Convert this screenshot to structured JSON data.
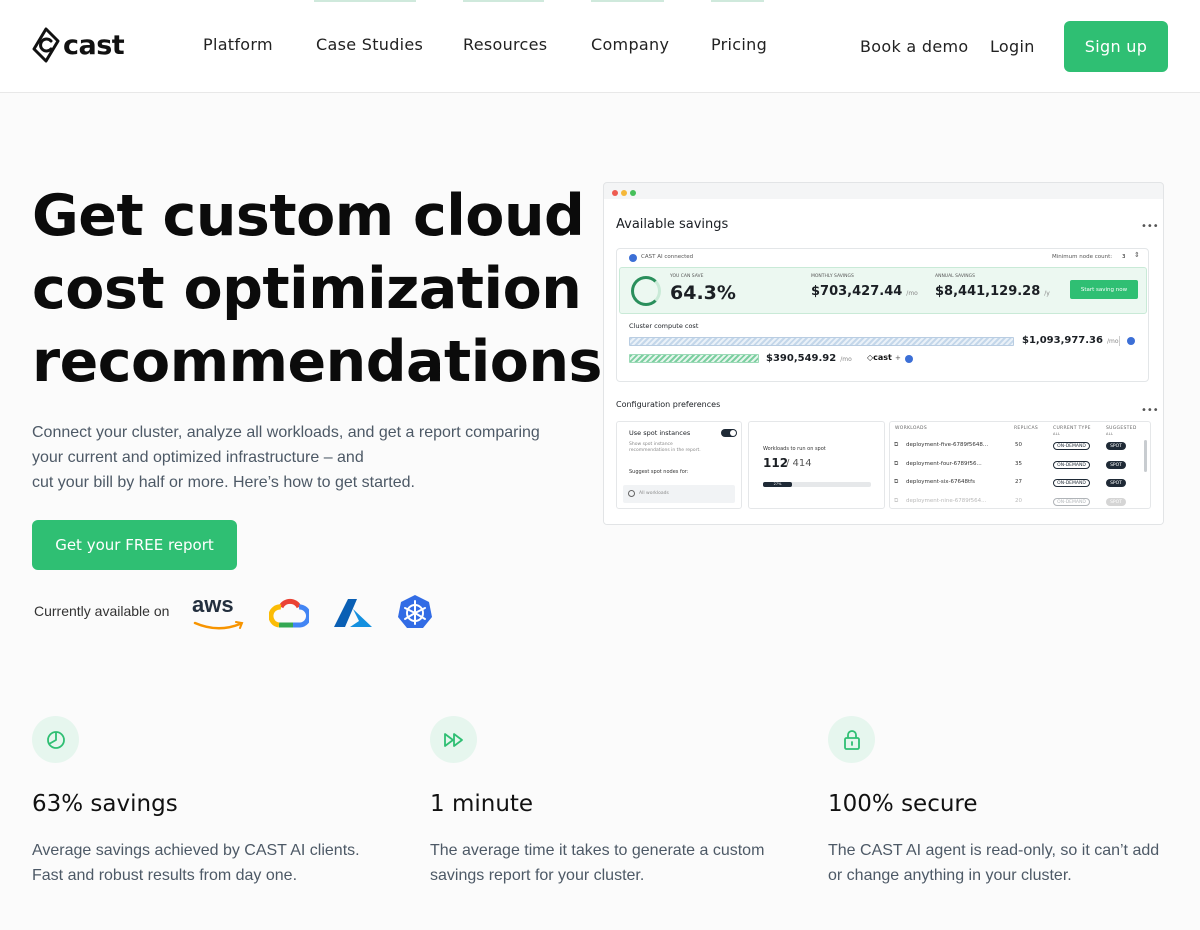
{
  "brand": {
    "name": "cast",
    "accent": "#2fbf73"
  },
  "nav": {
    "items": [
      "Platform",
      "Case Studies",
      "Resources",
      "Company",
      "Pricing"
    ],
    "book_demo": "Book a demo",
    "login": "Login",
    "signup": "Sign up"
  },
  "hero": {
    "title": "Get custom cloud cost optimization recommendations",
    "subtitle_lines": [
      "Connect your cluster, analyze all workloads, and get a report comparing",
      "your current and optimized infrastructure – and",
      "cut your bill by half or more. Here’s how to get started."
    ],
    "cta": "Get your FREE report",
    "available_label": "Currently available on",
    "providers": [
      "aws-icon",
      "google-cloud-icon",
      "azure-icon",
      "kubernetes-icon"
    ],
    "aws_text": "aws"
  },
  "dashboard": {
    "title": "Available savings",
    "connected": "CAST AI connected",
    "min_node_label": "Minimum node count:",
    "min_node_value": "3",
    "you_can_save_label": "YOU CAN SAVE",
    "you_can_save": "64.3%",
    "monthly_label": "MONTHLY SAVINGS",
    "monthly": "$703,427.44",
    "monthly_unit": "/mo",
    "annual_label": "ANNUAL SAVINGS",
    "annual": "$8,441,129.28",
    "annual_unit": "/y",
    "start_btn": "Start saving now",
    "cluster_cost_label": "Cluster compute cost",
    "current_cost": "$1,093,977.36",
    "current_unit": "/mo",
    "optimized_cost": "$390,549.92",
    "optimized_unit": "/mo",
    "cast_mini": "cast",
    "plus": "+",
    "config_title": "Configuration preferences",
    "spot_label": "Use spot instances",
    "spot_desc_1": "Show spot instance",
    "spot_desc_2": "recommendations in the report.",
    "suggest_label": "Suggest spot nodes for:",
    "all_workloads": "All workloads",
    "workloads_spot_label": "Workloads to run on spot",
    "workloads_spot": "112",
    "workloads_total": "/ 414",
    "workloads_pct": "27%",
    "table_headers": {
      "workloads": "WORKLOADS",
      "replicas": "REPLICAS",
      "current": "CURRENT TYPE",
      "suggested": "SUGGESTED",
      "all": "ALL"
    },
    "rows": [
      {
        "name": "deployment-five-6789f5648...",
        "replicas": "50",
        "current": "ON-DEMAND",
        "suggested": "SPOT"
      },
      {
        "name": "deployment-four-6789f56...",
        "replicas": "35",
        "current": "ON-DEMAND",
        "suggested": "SPOT"
      },
      {
        "name": "deployment-six-67648tfs",
        "replicas": "27",
        "current": "ON-DEMAND",
        "suggested": "SPOT"
      },
      {
        "name": "deployment-nine-6789f564...",
        "replicas": "20",
        "current": "ON-DEMAND",
        "suggested": "SPOT"
      }
    ]
  },
  "features": [
    {
      "icon": "pie-chart-icon",
      "title": "63% savings",
      "desc_lines": [
        "Average savings achieved by CAST AI clients.",
        "Fast and robust results from day one."
      ]
    },
    {
      "icon": "fast-forward-icon",
      "title": "1 minute",
      "desc_lines": [
        "The average time it takes to generate a custom",
        "savings report for your cluster."
      ]
    },
    {
      "icon": "lock-icon",
      "title": "100% secure",
      "desc_lines": [
        "The CAST AI agent is read-only, so it can’t add",
        "or change anything in your cluster."
      ]
    }
  ]
}
